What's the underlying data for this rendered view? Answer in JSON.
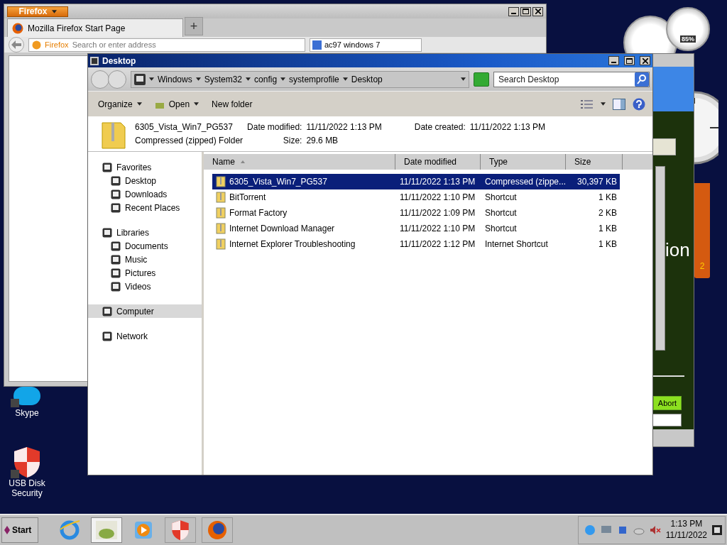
{
  "firefox": {
    "menu_button": "Firefox",
    "tabs": [
      {
        "label": "Mozilla Firefox Start Page",
        "selected": true
      }
    ],
    "new_tab": "+",
    "identity": "Firefox",
    "address_placeholder": "Search or enter address",
    "search_value": "ac97 windows 7"
  },
  "gadgets": {
    "cpu_reading": "85%",
    "note_text": "2"
  },
  "background_window": {
    "heading_fragment": "ion",
    "button": "Abort"
  },
  "explorer": {
    "title": "Desktop",
    "breadcrumb": [
      "Windows",
      "System32",
      "config",
      "systemprofile",
      "Desktop"
    ],
    "search_placeholder": "Search Desktop",
    "toolbar": [
      {
        "label": "Organize",
        "dropdown": true
      },
      {
        "label": "Open",
        "dropdown": true
      },
      {
        "label": "New folder",
        "dropdown": false
      }
    ],
    "details": {
      "name": "6305_Vista_Win7_PG537",
      "type": "Compressed (zipped) Folder",
      "modified_label": "Date modified:",
      "modified": "11/11/2022 1:13 PM",
      "created_label": "Date created:",
      "created": "11/11/2022 1:13 PM",
      "size_label": "Size:",
      "size": "29.6 MB"
    },
    "nav": [
      {
        "label": "Favorites",
        "selected": false,
        "children": [
          {
            "label": "Desktop",
            "selected": false
          },
          {
            "label": "Downloads",
            "selected": false
          },
          {
            "label": "Recent Places",
            "selected": false
          }
        ]
      },
      {
        "label": "Libraries",
        "selected": false,
        "children": [
          {
            "label": "Documents",
            "selected": false
          },
          {
            "label": "Music",
            "selected": false
          },
          {
            "label": "Pictures",
            "selected": false
          },
          {
            "label": "Videos",
            "selected": false
          }
        ]
      },
      {
        "label": "Computer",
        "selected": true
      },
      {
        "label": "Network",
        "selected": false
      }
    ],
    "columns": [
      {
        "label": "Name",
        "sorted": true
      },
      {
        "label": "Date modified",
        "sorted": false
      },
      {
        "label": "Type",
        "sorted": false
      },
      {
        "label": "Size",
        "sorted": false
      }
    ],
    "rows": [
      {
        "name": "6305_Vista_Win7_PG537",
        "modified": "11/11/2022 1:13 PM",
        "type": "Compressed (zippe...",
        "size": "30,397 KB",
        "selected": true
      },
      {
        "name": "BitTorrent",
        "modified": "11/11/2022 1:10 PM",
        "type": "Shortcut",
        "size": "1 KB",
        "selected": false
      },
      {
        "name": "Format Factory",
        "modified": "11/11/2022 1:09 PM",
        "type": "Shortcut",
        "size": "2 KB",
        "selected": false
      },
      {
        "name": "Internet Download Manager",
        "modified": "11/11/2022 1:10 PM",
        "type": "Shortcut",
        "size": "1 KB",
        "selected": false
      },
      {
        "name": "Internet Explorer Troubleshooting",
        "modified": "11/11/2022 1:12 PM",
        "type": "Internet Shortcut",
        "size": "1 KB",
        "selected": false
      }
    ]
  },
  "desktop_icons": [
    {
      "label": "Skype"
    },
    {
      "label": "USB Disk Security"
    }
  ],
  "taskbar": {
    "start": "Start",
    "apps": [
      {
        "selected": false
      },
      {
        "selected": true
      },
      {
        "selected": false
      },
      {
        "selected": false
      },
      {
        "selected": false
      }
    ],
    "time": "1:13 PM",
    "date": "11/11/2022"
  }
}
